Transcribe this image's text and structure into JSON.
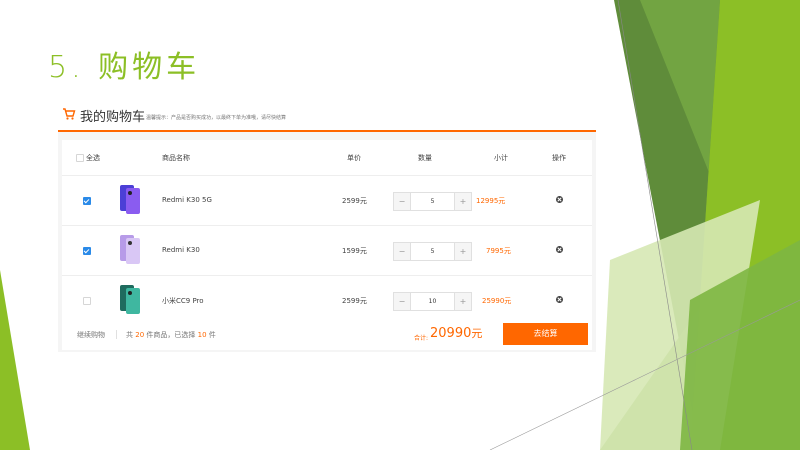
{
  "slide": {
    "title": "5. 购物车",
    "accent": "#8cbf26"
  },
  "cart": {
    "title": "我的购物车",
    "tip": "温馨提示：产品是否购买成功，以最终下单为准哦，请尽快结算",
    "accent": "#ff6700",
    "headers": {
      "select_all": "全选",
      "name": "商品名称",
      "price": "单价",
      "qty": "数量",
      "subtotal": "小计",
      "action": "操作"
    },
    "items": [
      {
        "name": "Redmi K30 5G",
        "price": "2599元",
        "qty": "5",
        "subtotal": "12995元",
        "checked": true
      },
      {
        "name": "Redmi K30",
        "price": "1599元",
        "qty": "5",
        "subtotal": "7995元",
        "checked": true
      },
      {
        "name": "小米CC9 Pro",
        "price": "2599元",
        "qty": "10",
        "subtotal": "25990元",
        "checked": false
      }
    ],
    "qty_minus": "−",
    "qty_plus": "+",
    "footer": {
      "continue": "继续购物",
      "info_prefix": "共 ",
      "total_count": "20",
      "info_mid": " 件商品，已选择 ",
      "selected_count": "10",
      "info_suffix": " 件",
      "total_label": "合计:",
      "total_value": "20990",
      "total_unit": "元",
      "checkout": "去结算"
    }
  }
}
